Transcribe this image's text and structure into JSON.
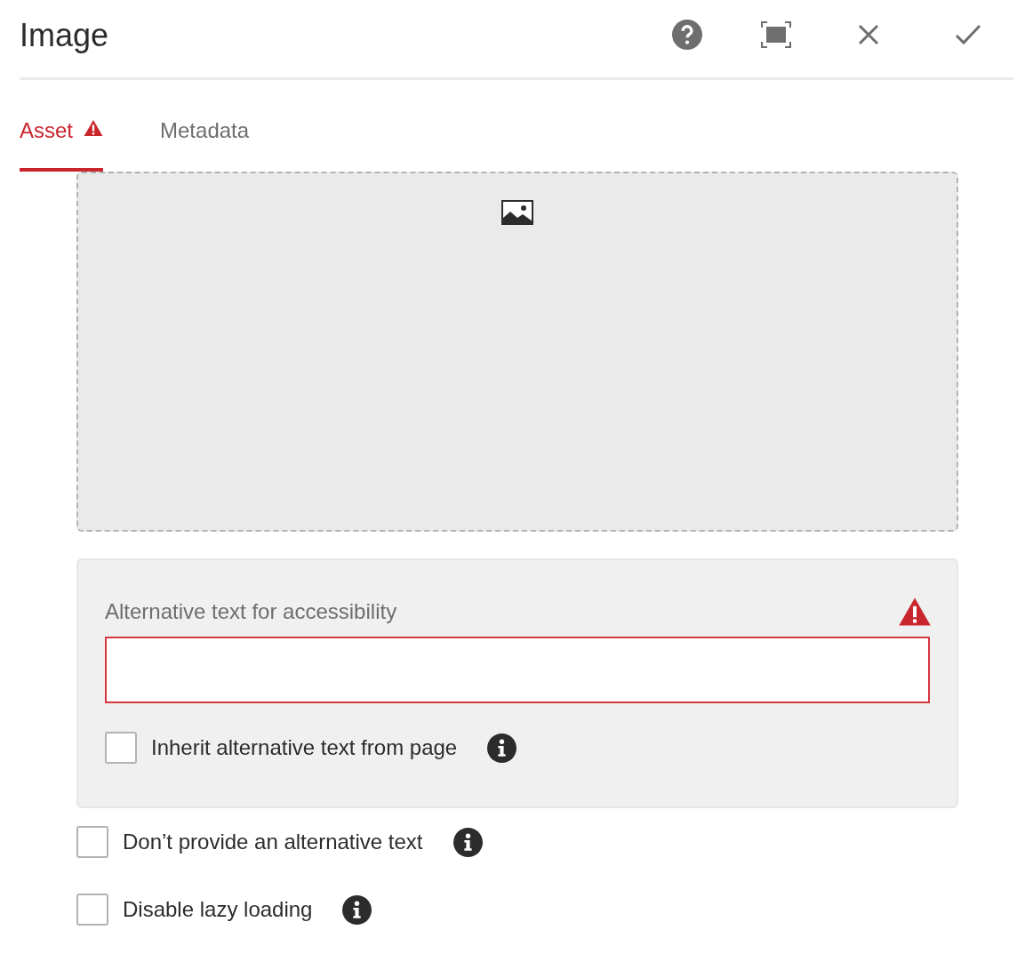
{
  "header": {
    "title": "Image"
  },
  "tabs": [
    {
      "label": "Asset",
      "selected": true,
      "invalid": true
    },
    {
      "label": "Metadata",
      "selected": false,
      "invalid": false
    }
  ],
  "alt_text": {
    "label": "Alternative text for accessibility",
    "invalid": true,
    "inherit": {
      "label": "Inherit alternative text from page",
      "checked": false
    }
  },
  "options": [
    {
      "label": "Don’t provide an alternative text",
      "checked": false
    },
    {
      "label": "Disable lazy loading",
      "checked": false
    }
  ]
}
